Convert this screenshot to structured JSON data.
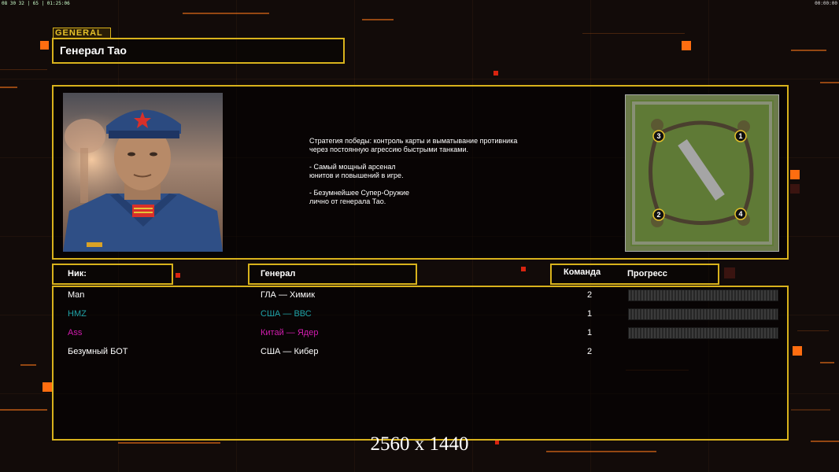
{
  "overlay": {
    "fps": "08 30 32 | 65 | 01:25:06",
    "clock": "00:00:00"
  },
  "general": {
    "tag": "GENERAL",
    "name": "Генерал Тао"
  },
  "description": "Стратегия победы: контроль карты и выматывание противника\n через постоянную агрессию быстрыми танками.\n\n- Самый мощный арсенал\nюнитов и повышений в игре.\n\n- Безумнейшее Супер-Оружие\nлично от генерала Тао.",
  "portrait": {
    "icon": "general-portrait"
  },
  "minimap": {
    "icon": "map-preview",
    "spawns": [
      "1",
      "2",
      "3",
      "4"
    ]
  },
  "headers": {
    "nick": "Ник:",
    "general": "Генерал",
    "team": "Команда",
    "progress": "Прогресс"
  },
  "players": [
    {
      "nick": "Man",
      "general": "ГЛА — Химик",
      "team": "2",
      "color": "#ffffff",
      "progress": 0
    },
    {
      "nick": "HMZ",
      "general": "США — ВВС",
      "team": "1",
      "color": "#1fa3a8",
      "progress": 0
    },
    {
      "nick": "Ass",
      "general": "Китай — Ядер",
      "team": "1",
      "color": "#d21cae",
      "progress": 0
    },
    {
      "nick": "Безумный БОТ",
      "general": "США — Кибер",
      "team": "2",
      "color": "#ffffff",
      "progress": null
    }
  ],
  "resolution": "2560 x 1440"
}
